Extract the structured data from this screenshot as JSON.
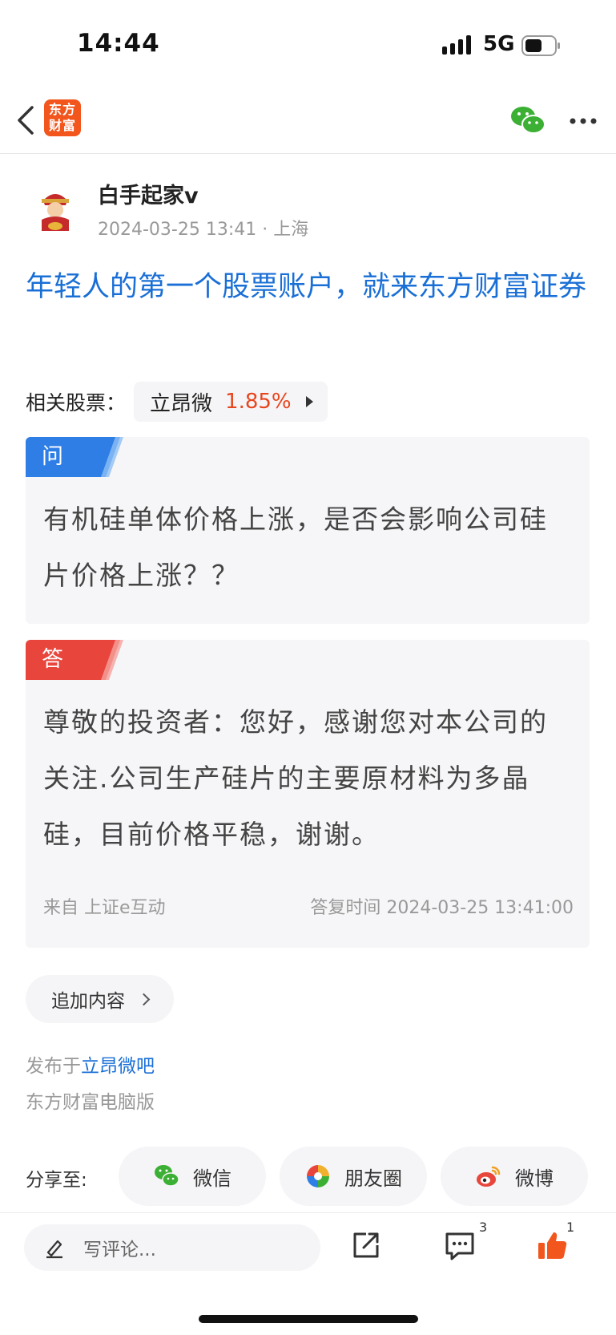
{
  "status_bar": {
    "time": "14:44",
    "network": "5G"
  },
  "nav": {
    "logo_text_line1": "东方",
    "logo_text_line2": "财富",
    "logo_color": "#f2561d"
  },
  "post": {
    "author": "白手起家v",
    "meta": "2024-03-25 13:41 · 上海",
    "title": "年轻人的第一个股票账户，就来东方财富证券",
    "related_label": "相关股票：",
    "stock_name": "立昂微",
    "stock_change": "1.85%"
  },
  "question": {
    "tag": "问",
    "text": "有机硅单体价格上涨，是否会影响公司硅片价格上涨？？"
  },
  "answer": {
    "tag": "答",
    "text": "尊敬的投资者：您好，感谢您对本公司的关注.公司生产硅片的主要原材料为多晶硅，目前价格平稳，谢谢。",
    "source": "来自 上证e互动",
    "reply_time": "答复时间 2024-03-25 13:41:00"
  },
  "append_label": "追加内容",
  "published": {
    "prefix": "发布于",
    "bar": "立昂微吧"
  },
  "pc_version": "东方财富电脑版",
  "share": {
    "label": "分享至:",
    "wechat": "微信",
    "moments": "朋友圈",
    "weibo": "微博"
  },
  "bottom": {
    "comment_placeholder": "写评论...",
    "comment_count": "3",
    "like_count": "1"
  },
  "colors": {
    "link_blue": "#1a6fd6",
    "up_red": "#e8451d",
    "q_blue": "#2e7ee6",
    "a_red": "#e8453c",
    "like_orange": "#f2561d"
  }
}
